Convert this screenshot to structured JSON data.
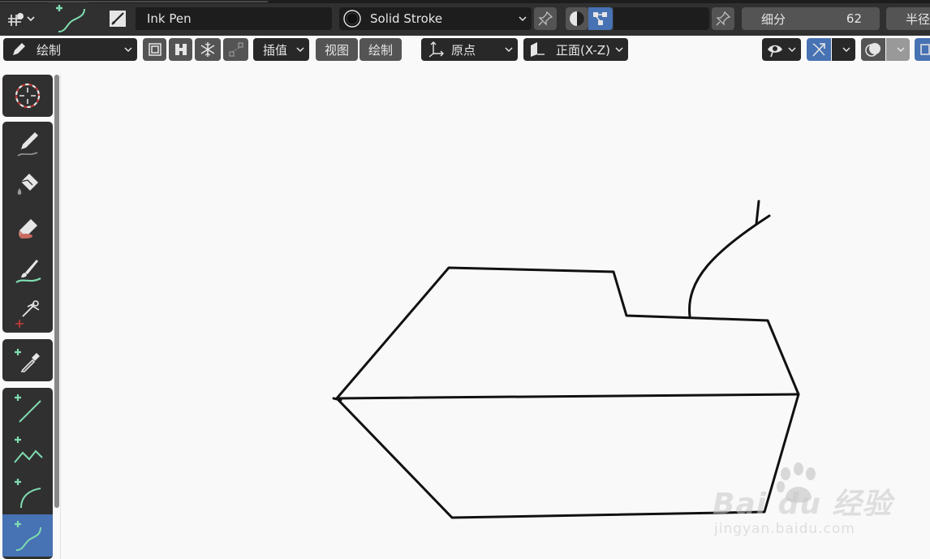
{
  "header": {
    "brush_name": "Ink Pen",
    "material_name": "Solid Stroke",
    "subdivide_label": "细分",
    "subdivide_value": "62",
    "radius_label": "半径"
  },
  "header2": {
    "mode_label": "绘制",
    "interpolate_label": "插值",
    "view_label": "视图",
    "draw_label": "绘制",
    "origin_label": "原点",
    "plane_label": "正面(X-Z)"
  },
  "toolbar": {
    "tools": [
      "cursor",
      "draw",
      "fill",
      "erase",
      "tint",
      "cutter",
      "eyedropper",
      "line",
      "polyline",
      "arc",
      "curve"
    ],
    "active_tool": "curve"
  },
  "watermark": {
    "brand": "Bai du 经验",
    "url": "jingyan.baidu.com"
  },
  "colors": {
    "accent": "#4772b3",
    "panel": "#303030",
    "field": "#1d1d1d",
    "canvas": "#f9f9f9",
    "stroke": "#111111",
    "tool_green": "#7fdcb0"
  }
}
